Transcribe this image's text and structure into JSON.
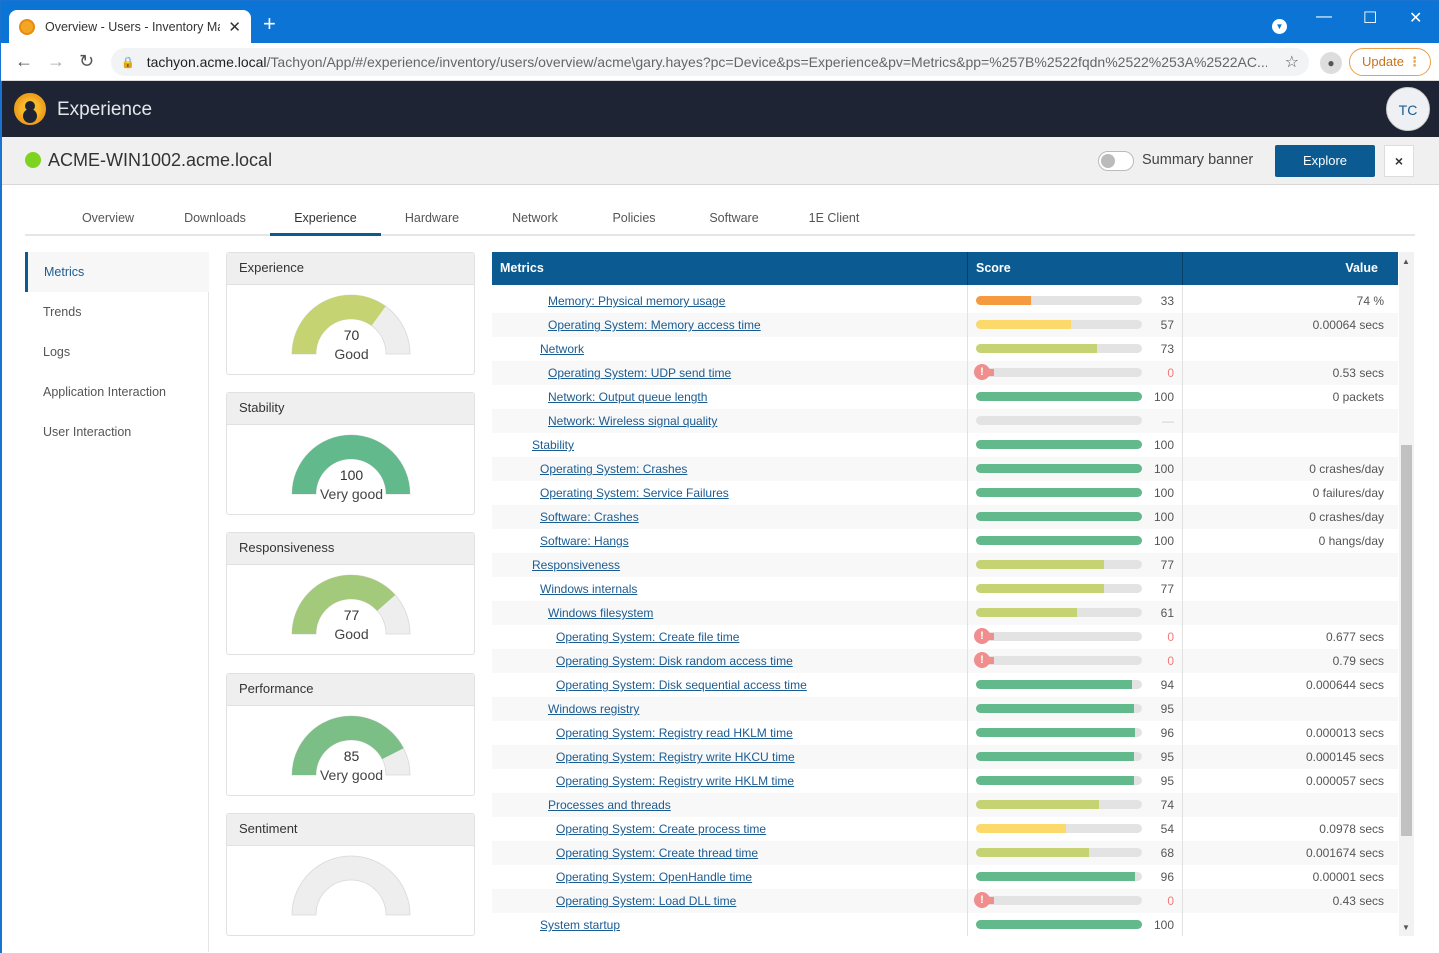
{
  "browser": {
    "tab_title": "Overview - Users - Inventory Mar",
    "new_tab": "+",
    "url_host": "tachyon.acme.local",
    "url_path": "/Tachyon/App/#/experience/inventory/users/overview/acme\\gary.hayes?pc=Device&ps=Experience&pv=Metrics&pp=%257B%2522fqdn%2522%253A%2522AC...",
    "update_label": "Update"
  },
  "app": {
    "title": "Experience",
    "user_initials": "TC"
  },
  "device": {
    "name": "ACME-WIN1002.acme.local",
    "status_color": "#7ed321",
    "summary_banner_label": "Summary banner",
    "summary_banner_on": false,
    "explore_label": "Explore",
    "close_label": "×"
  },
  "tabs": [
    {
      "label": "Overview",
      "active": false
    },
    {
      "label": "Downloads",
      "active": false
    },
    {
      "label": "Experience",
      "active": true
    },
    {
      "label": "Hardware",
      "active": false
    },
    {
      "label": "Network",
      "active": false
    },
    {
      "label": "Policies",
      "active": false
    },
    {
      "label": "Software",
      "active": false
    },
    {
      "label": "1E Client",
      "active": false
    }
  ],
  "side_menu": [
    {
      "label": "Metrics",
      "active": true
    },
    {
      "label": "Trends",
      "active": false
    },
    {
      "label": "Logs",
      "active": false
    },
    {
      "label": "Application Interaction",
      "active": false
    },
    {
      "label": "User Interaction",
      "active": false
    }
  ],
  "gauges": [
    {
      "title": "Experience",
      "score": 70,
      "rating": "Good",
      "color": "#c5d372"
    },
    {
      "title": "Stability",
      "score": 100,
      "rating": "Very good",
      "color": "#62b98b"
    },
    {
      "title": "Responsiveness",
      "score": 77,
      "rating": "Good",
      "color": "#a3c97a"
    },
    {
      "title": "Performance",
      "score": 85,
      "rating": "Very good",
      "color": "#7bbf87"
    },
    {
      "title": "Sentiment",
      "score": null,
      "rating": "",
      "color": "#eeeeee"
    }
  ],
  "table": {
    "headers": {
      "metrics": "Metrics",
      "score": "Score",
      "value": "Value"
    },
    "rows": [
      {
        "name": "Memory: Physical memory usage",
        "level": 3,
        "score": 33,
        "value": "74 %"
      },
      {
        "name": "Operating System: Memory access time",
        "level": 3,
        "score": 57,
        "value": "0.00064 secs"
      },
      {
        "name": "Network",
        "level": 2,
        "score": 73,
        "value": ""
      },
      {
        "name": "Operating System: UDP send time",
        "level": 3,
        "score": 0,
        "value": "0.53 secs"
      },
      {
        "name": "Network: Output queue length",
        "level": 3,
        "score": 100,
        "value": "0 packets"
      },
      {
        "name": "Network: Wireless signal quality",
        "level": 3,
        "score": null,
        "value": ""
      },
      {
        "name": "Stability",
        "level": 1,
        "score": 100,
        "value": ""
      },
      {
        "name": "Operating System: Crashes",
        "level": 2,
        "score": 100,
        "value": "0 crashes/day"
      },
      {
        "name": "Operating System: Service Failures",
        "level": 2,
        "score": 100,
        "value": "0 failures/day"
      },
      {
        "name": "Software: Crashes",
        "level": 2,
        "score": 100,
        "value": "0 crashes/day"
      },
      {
        "name": "Software: Hangs",
        "level": 2,
        "score": 100,
        "value": "0 hangs/day"
      },
      {
        "name": "Responsiveness",
        "level": 1,
        "score": 77,
        "value": ""
      },
      {
        "name": "Windows internals",
        "level": 2,
        "score": 77,
        "value": ""
      },
      {
        "name": "Windows filesystem",
        "level": 3,
        "score": 61,
        "value": ""
      },
      {
        "name": "Operating System: Create file time",
        "level": 4,
        "score": 0,
        "value": "0.677 secs"
      },
      {
        "name": "Operating System: Disk random access time",
        "level": 4,
        "score": 0,
        "value": "0.79 secs"
      },
      {
        "name": "Operating System: Disk sequential access time",
        "level": 4,
        "score": 94,
        "value": "0.000644 secs"
      },
      {
        "name": "Windows registry",
        "level": 3,
        "score": 95,
        "value": ""
      },
      {
        "name": "Operating System: Registry read HKLM time",
        "level": 4,
        "score": 96,
        "value": "0.000013 secs"
      },
      {
        "name": "Operating System: Registry write HKCU time",
        "level": 4,
        "score": 95,
        "value": "0.000145 secs"
      },
      {
        "name": "Operating System: Registry write HKLM time",
        "level": 4,
        "score": 95,
        "value": "0.000057 secs"
      },
      {
        "name": "Processes and threads",
        "level": 3,
        "score": 74,
        "value": ""
      },
      {
        "name": "Operating System: Create process time",
        "level": 4,
        "score": 54,
        "value": "0.0978 secs"
      },
      {
        "name": "Operating System: Create thread time",
        "level": 4,
        "score": 68,
        "value": "0.001674 secs"
      },
      {
        "name": "Operating System: OpenHandle time",
        "level": 4,
        "score": 96,
        "value": "0.00001 secs"
      },
      {
        "name": "Operating System: Load DLL time",
        "level": 4,
        "score": 0,
        "value": "0.43 secs"
      },
      {
        "name": "System startup",
        "level": 2,
        "score": 100,
        "value": ""
      }
    ],
    "na_symbol": "—"
  },
  "score_colors": {
    "poor": "#f59a3f",
    "fair": "#fcd96b",
    "good": "#c5d372",
    "very_good": "#62b98b",
    "zero": "#f08d8d"
  }
}
